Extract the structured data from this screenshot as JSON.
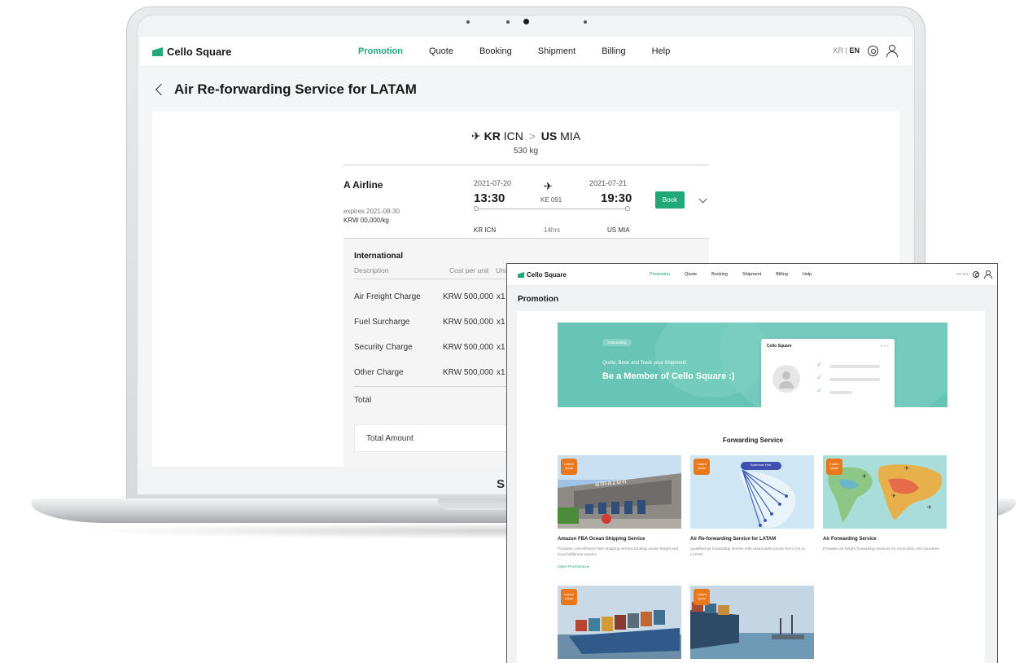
{
  "laptop": {
    "header": {
      "brand": "Cello Square",
      "nav": [
        "Promotion",
        "Quote",
        "Booking",
        "Shipment",
        "Billing",
        "Help"
      ],
      "active_nav": "Promotion",
      "lang_kr": "KR",
      "lang_sep": "|",
      "lang_en": "EN"
    },
    "page_title": "Air Re-forwarding Service for LATAM",
    "route": {
      "origin_country": "KR",
      "origin_port": "ICN",
      "separator": ">",
      "dest_country": "US",
      "dest_port": "MIA",
      "weight": "530 kg"
    },
    "offer": {
      "airline": "A Airline",
      "expires": "expires 2021-08-30",
      "rate": "KRW 00,000/kg",
      "depart_date": "2021-07-20",
      "depart_time": "13:30",
      "arrive_date": "2021-07-21",
      "arrive_time": "19:30",
      "flight_no": "KE 091",
      "origin_code": "KR ICN",
      "duration": "14hrs",
      "dest_code": "US MIA",
      "book_label": "Book"
    },
    "breakdown": {
      "title": "International",
      "col_description": "Description",
      "col_cost": "Cost per unit",
      "col_unit": "Uni",
      "rows": [
        {
          "desc": "Air Freight Charge",
          "cost": "KRW 500,000",
          "qty": "x1"
        },
        {
          "desc": "Fuel Surcharge",
          "cost": "KRW 500,000",
          "qty": "x1"
        },
        {
          "desc": "Security Charge",
          "cost": "KRW 500,000",
          "qty": "x1"
        },
        {
          "desc": "Other Charge",
          "cost": "KRW 500,000",
          "qty": "x1"
        }
      ],
      "total_label": "Total",
      "total_amount_label": "Total Amount"
    },
    "cutoff_letter": "S"
  },
  "overlay": {
    "header": {
      "brand": "Cello Square",
      "nav": [
        "Promotion",
        "Quote",
        "Booking",
        "Shipment",
        "Billing",
        "Help"
      ],
      "active_nav": "Promotion",
      "lang": "KR EN"
    },
    "page_title": "Promotion",
    "banner": {
      "pill": "Onboarding",
      "subtitle": "Quote, Book and Track your Shipment!",
      "headline": "Be a Member of Cello Square :)",
      "window_title": "Cello Square"
    },
    "section_title": "Forwarding Service",
    "badge_text": "Instant Quote",
    "services": [
      {
        "name": "Amazon FBA Ocean Shipping Service",
        "desc": "Provides cost-efficient FBA shipping service binding ocean freight and local fulfillment service",
        "link": "Open Promotion ▸"
      },
      {
        "name": "Air Re-forwarding Service for LATAM",
        "desc": "Qualified air forwarding service with reasonable prices from ICN to LATAM",
        "link": ""
      },
      {
        "name": "Air Forwarding Service",
        "desc": "Provides air freight forwarding services for more than 100 countries",
        "link": ""
      }
    ],
    "tile_texts": {
      "amazon_sign": "amazon",
      "map_pill": "Americas Hub"
    }
  },
  "colors": {
    "brand_green": "#20a878",
    "banner_teal": "#68c5b6",
    "badge_orange": "#e9781d"
  },
  "icons": [
    "back-chevron-icon",
    "plane-icon",
    "expand-chevron-icon",
    "globe-icon",
    "user-icon",
    "check-icon"
  ]
}
